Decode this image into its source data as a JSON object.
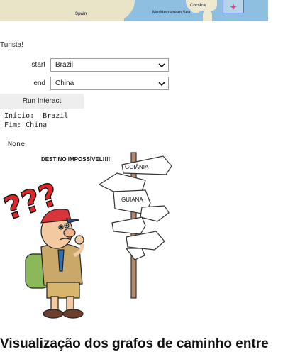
{
  "map": {
    "labels": {
      "spain": "Spain",
      "mediterranean": "Mediterranean Sea",
      "corsica": "Corsica"
    }
  },
  "app": {
    "title": "Turista!"
  },
  "form": {
    "start": {
      "label": "start",
      "value": "Brazil"
    },
    "end": {
      "label": "end",
      "value": "China"
    },
    "run_label": "Run Interact"
  },
  "output": {
    "inicio": "Início:  Brazil",
    "fim": "Fim: China",
    "result": "None"
  },
  "illustration": {
    "caption": "DESTINO IMPOSSÍVEL!!!!",
    "sign_goiania": "GOIÂNIA",
    "sign_guiana": "GUIANA",
    "question_marks": "???"
  },
  "heading": "Visualização dos grafos de caminho entre",
  "colors": {
    "sea": "#8fbfe0",
    "land": "#e9e3c8",
    "button_bg": "#eeeeee",
    "question_red": "#e0262a"
  }
}
